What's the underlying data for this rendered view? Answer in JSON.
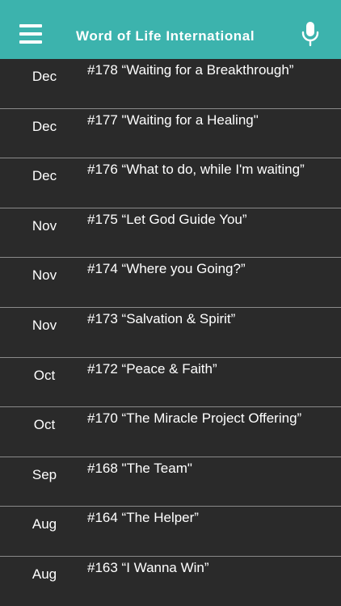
{
  "header": {
    "title": "Word of Life International",
    "background_color": "#3cb3ad",
    "menu_icon": "hamburger-menu-icon",
    "mic_icon": "microphone-icon"
  },
  "sermons": [
    {
      "month": "Dec",
      "title": "#178 “Waiting for a Breakthrough”"
    },
    {
      "month": "Dec",
      "title": "#177 \"Waiting for a Healing\""
    },
    {
      "month": "Dec",
      "title": "#176 “What to do, while I'm waiting”"
    },
    {
      "month": "Nov",
      "title": "#175 “Let God Guide You”"
    },
    {
      "month": "Nov",
      "title": "#174 “Where you Going?”"
    },
    {
      "month": "Nov",
      "title": "#173 “Salvation & Spirit”"
    },
    {
      "month": "Oct",
      "title": "#172 “Peace & Faith”"
    },
    {
      "month": "Oct",
      "title": "#170 “The Miracle Project Offering”"
    },
    {
      "month": "Sep",
      "title": "#168 \"The Team\""
    },
    {
      "month": "Aug",
      "title": "#164 “The Helper”"
    },
    {
      "month": "Aug",
      "title": "#163 “I Wanna Win”"
    }
  ]
}
